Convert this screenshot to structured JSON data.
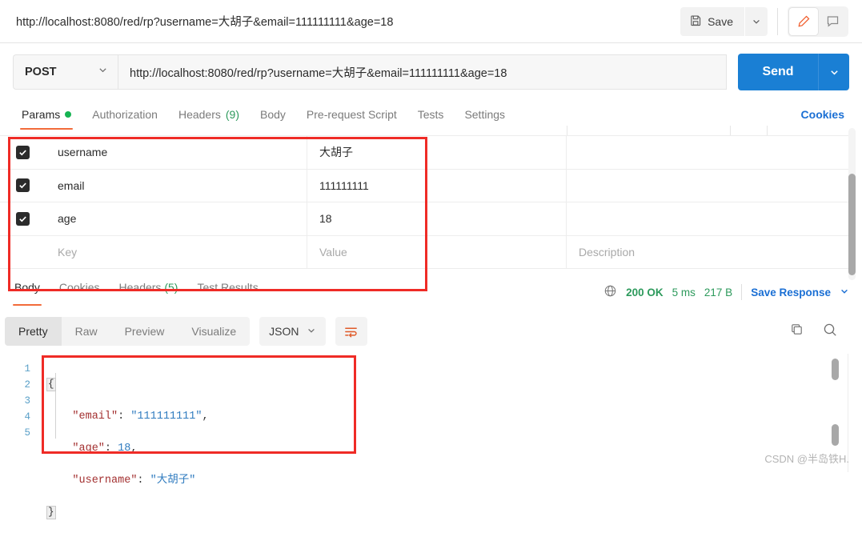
{
  "header": {
    "request_title": "http://localhost:8080/red/rp?username=大胡子&email=111111111&age=18",
    "save_label": "Save",
    "icons": {
      "save": "floppy-disk-icon",
      "save_caret": "chevron-down-icon",
      "pencil": "pencil-icon",
      "comment": "comment-icon"
    }
  },
  "url_row": {
    "method": "POST",
    "url": "http://localhost:8080/red/rp?username=大胡子&email=111111111&age=18",
    "send_label": "Send"
  },
  "request_tabs": {
    "items": [
      {
        "label": "Params",
        "active": true,
        "dot": true
      },
      {
        "label": "Authorization",
        "active": false
      },
      {
        "label": "Headers",
        "count": "(9)",
        "active": false
      },
      {
        "label": "Body",
        "active": false
      },
      {
        "label": "Pre-request Script",
        "active": false
      },
      {
        "label": "Tests",
        "active": false
      },
      {
        "label": "Settings",
        "active": false
      }
    ],
    "cookies_label": "Cookies"
  },
  "params_table": {
    "placeholders": {
      "key": "Key",
      "value": "Value",
      "description": "Description"
    },
    "rows": [
      {
        "checked": true,
        "key": "username",
        "value": "大胡子",
        "description": ""
      },
      {
        "checked": true,
        "key": "email",
        "value": "111111111",
        "description": ""
      },
      {
        "checked": true,
        "key": "age",
        "value": "18",
        "description": ""
      }
    ]
  },
  "response_tabs": {
    "items": [
      {
        "label": "Body",
        "active": true
      },
      {
        "label": "Cookies",
        "active": false
      },
      {
        "label": "Headers",
        "count": "(5)",
        "active": false
      },
      {
        "label": "Test Results",
        "active": false
      }
    ]
  },
  "status": {
    "globe_icon": "globe-icon",
    "code": "200 OK",
    "time": "5 ms",
    "size": "217 B",
    "save_response_label": "Save Response"
  },
  "body_toolbar": {
    "views": [
      {
        "label": "Pretty",
        "active": true
      },
      {
        "label": "Raw",
        "active": false
      },
      {
        "label": "Preview",
        "active": false
      },
      {
        "label": "Visualize",
        "active": false
      }
    ],
    "format": "JSON",
    "wrap_icon": "word-wrap-icon",
    "copy_icon": "copy-icon",
    "search_icon": "search-icon"
  },
  "response_body": {
    "line_numbers": [
      "1",
      "2",
      "3",
      "4",
      "5"
    ],
    "lines": [
      {
        "n": 1,
        "text": "{",
        "kind": "fold-open"
      },
      {
        "n": 2,
        "key": "\"email\"",
        "value": "\"111111111\"",
        "value_kind": "string",
        "trailing": ","
      },
      {
        "n": 3,
        "key": "\"age\"",
        "value": "18",
        "value_kind": "number",
        "trailing": ","
      },
      {
        "n": 4,
        "key": "\"username\"",
        "value": "\"大胡子\"",
        "value_kind": "string",
        "trailing": ""
      },
      {
        "n": 5,
        "text": "}",
        "kind": "fold-close"
      }
    ]
  },
  "colors": {
    "accent_orange": "#f26b3a",
    "send_blue": "#1a7fd4",
    "link_blue": "#1a6fd4",
    "status_green": "#2d9a5c",
    "annotation_red": "#ef2b26"
  },
  "watermark": "CSDN @半岛铁H."
}
